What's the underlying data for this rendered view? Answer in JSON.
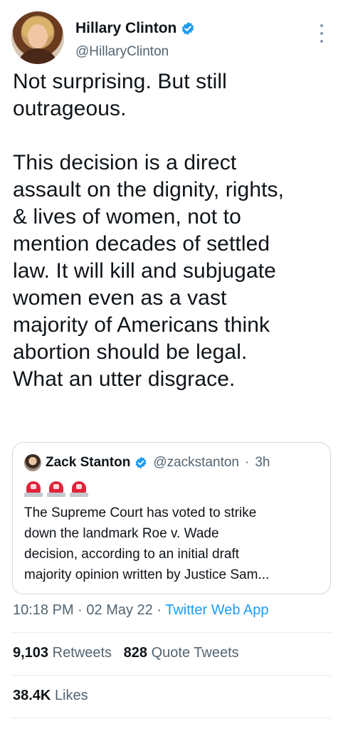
{
  "author": {
    "name": "Hillary Clinton",
    "handle": "@HillaryClinton"
  },
  "tweet": {
    "text": "Not surprising. But still\noutrageous.\n\nThis decision is a direct\nassault on the dignity, rights,\n& lives of women, not to\nmention decades of settled\nlaw. It will kill and subjugate\nwomen even as a vast\nmajority of Americans think\nabortion should be legal.\nWhat an utter disgrace."
  },
  "quoted": {
    "name": "Zack Stanton",
    "handle": "@zackstanton",
    "separator": "·",
    "time": "3h",
    "emoji_icons": [
      "police-siren-icon",
      "police-siren-icon",
      "police-siren-icon"
    ],
    "text": "The Supreme Court has voted to strike\ndown the landmark Roe v. Wade\ndecision, according to an initial draft\nmajority opinion written by Justice Sam..."
  },
  "meta": {
    "time": "10:18 PM",
    "separator": "·",
    "date": "02 May 22",
    "separator2": "·",
    "app": "Twitter Web App"
  },
  "stats": {
    "retweets_count": "9,103",
    "retweets_label": "Retweets",
    "quotes_count": "828",
    "quotes_label": "Quote Tweets",
    "likes_count": "38.4K",
    "likes_label": "Likes"
  },
  "colors": {
    "verified": "#1d9bf0",
    "link": "#1d9bf0",
    "secondary_text": "#536471",
    "siren": "#e0243a"
  }
}
